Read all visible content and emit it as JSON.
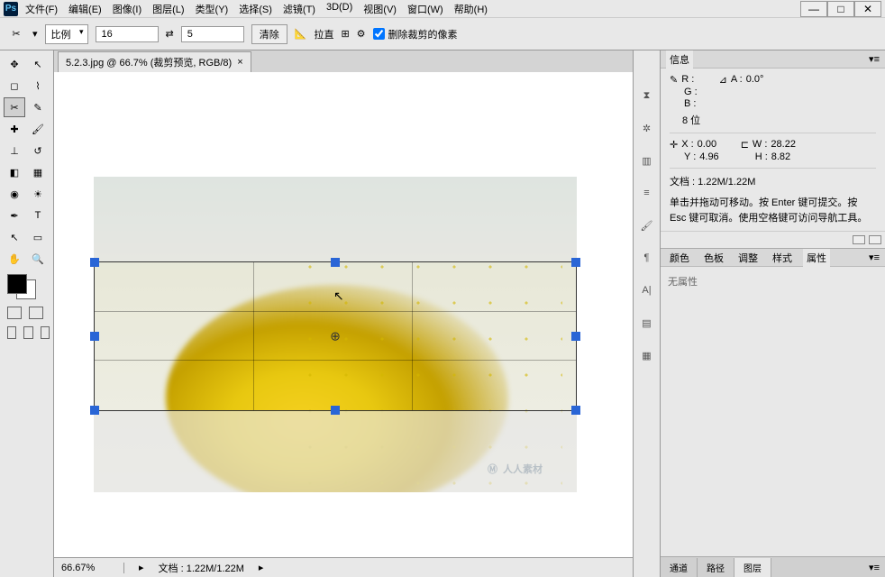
{
  "menu": {
    "file": "文件(F)",
    "edit": "编辑(E)",
    "image": "图像(I)",
    "layer": "图层(L)",
    "type": "类型(Y)",
    "select": "选择(S)",
    "filter": "滤镜(T)",
    "3d": "3D(D)",
    "view": "视图(V)",
    "window": "窗口(W)",
    "help": "帮助(H)"
  },
  "options": {
    "ratio_label": "比例",
    "width": "16",
    "height": "5",
    "clear": "清除",
    "straighten": "拉直",
    "delete_pixels": "删除裁剪的像素"
  },
  "doc_tab": {
    "title": "5.2.3.jpg @ 66.7% (裁剪预览, RGB/8)",
    "close": "×"
  },
  "status": {
    "zoom": "66.67%",
    "doc": "文档 : 1.22M/1.22M"
  },
  "info": {
    "title": "信息",
    "r": "R :",
    "g": "G :",
    "b": "B :",
    "bits": "8 位",
    "angle_label": "A :",
    "angle_val": "0.0°",
    "x": "X :",
    "x_val": "0.00",
    "y": "Y :",
    "y_val": "4.96",
    "w": "W :",
    "w_val": "28.22",
    "h": "H :",
    "h_val": "8.82",
    "doc": "文档 : 1.22M/1.22M",
    "hint": "单击并拖动可移动。按 Enter 键可提交。按 Esc 键可取消。使用空格键可访问导航工具。"
  },
  "props": {
    "tabs": {
      "color": "颜色",
      "swatches": "色板",
      "adjust": "调整",
      "styles": "样式",
      "properties": "属性"
    },
    "empty": "无属性"
  },
  "bottom_tabs": {
    "channels": "通道",
    "paths": "路径",
    "layers": "图层"
  },
  "watermark": "人人素材",
  "ps_logo": "Ps"
}
